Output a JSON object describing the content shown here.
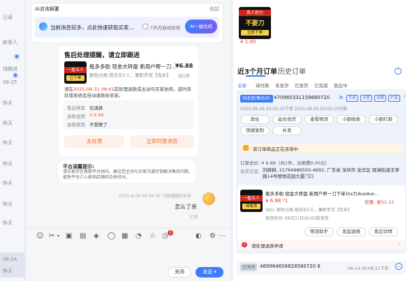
{
  "sidebar": {
    "items": [
      "已读",
      "新客人",
      "待跟进",
      "08-25",
      "昨天",
      "昨天",
      "昨天",
      "昨天",
      "昨天",
      "昨天",
      "昨天",
      "08-24",
      "昨天"
    ]
  },
  "top_bar": {
    "ai_summary_label": "AI咨询摘要",
    "collapse_label": "收起",
    "ai_notice": "当前消息较多，点此快速获取买家...",
    "checkbox_label": "7天内自动总结",
    "ai_button": "AI一键总结"
  },
  "after_sale": {
    "title": "售后处理提醒，请立即跟进",
    "product_title": "瓶多多助 现金大转盘 新用户帮一刀...",
    "product_sku": "颜色分类:搭去乐5人，兼职手贷【包补】",
    "price": "¥6.88",
    "qty": "共1件",
    "thumb_line1": "一盈五人",
    "thumb_line2": "已下单",
    "notice_prefix": "请在",
    "deadline": "2025-08-31 08:41",
    "notice_suffix": "前处理退款或主动与买家协商，超时未处理系统会自动退款给买家。",
    "rows": [
      {
        "label": "售后类型",
        "value": "仅退款"
      },
      {
        "label": "退款金额",
        "value": "¥ 6.88"
      },
      {
        "label": "退款原因",
        "value": "不想要了"
      }
    ],
    "btn_handle": "去处理",
    "btn_refund": "立即同意退款"
  },
  "platform_notice": {
    "title": "平台温馨提示:",
    "body": "请买家存在索取平台倾向，建议您主动与买家沟通尽快解决售后问题，避免平台介入影响店铺综合体验分。"
  },
  "conversation": {
    "timestamp": "2025-8-29 20:44:35 力能越殿奶朵朵",
    "message": "怎么了亲",
    "read_status": "已读"
  },
  "composer": {
    "badge_count": "1",
    "close_button": "关闭",
    "send_button": "发送"
  },
  "right_panel": {
    "top_price": "¥ 1.00",
    "top_thumb_line1": "真人助力",
    "top_thumb_line2": "不要刀",
    "top_thumb_line3": "立即下单",
    "tab_active": "近3个月订单",
    "tab_history": "历史订单",
    "filters": [
      "全部",
      "待付款",
      "未发货",
      "已发货",
      "已完成",
      "售后中"
    ],
    "order1": {
      "status": "待收货(售后中)",
      "order_no": "470965331158680720",
      "badges": [
        "手机",
        "评差",
        "多期",
        "扩容"
      ],
      "times": "2025-08-29 20:02:10下单   2025-08-29 20:02:15付款",
      "actions_row1": [
        "改址",
        "延长收货",
        "查看物流",
        "小额收款",
        "小额打款"
      ],
      "actions_row2": [
        "快捷复制",
        "补发"
      ],
      "consult_notice": "该订单商品正在咨询中",
      "amount_line": "订单总价: ¥ 6.88（共1件，含邮费0.00元）",
      "address_label": "收货信息:",
      "address": "刘耕耕, 15794986550-4692, 广东省 深圳市 龙华区 观澜街道丰翠路14号檀悦花园大厦门口",
      "product_title": "瓶多多助 现金大转盘 新用户帮一刀下单1tx力duoduo...",
      "price_line": "¥ 6.88 *1",
      "discount": "优惠: 省51.12",
      "sku": "SKU: 颜色分类:搭去乐5人，兼职手贷【包补】",
      "ship_time": "发货时间: 08月31日20:02前发货",
      "thumb_line1": "一盈五人",
      "thumb_line2": "待收货",
      "buttons": [
        "物流助手",
        "发起退换",
        "售后详情"
      ],
      "refund_notice": "请处理退款申请"
    },
    "order2": {
      "status": "已关闭",
      "order_no": "469964656828580720 6",
      "time": "08-24 00:08:31下单"
    }
  },
  "colors": {
    "accent": "#3f7cf7",
    "orange": "#f56c2d",
    "red": "#e4393c"
  }
}
